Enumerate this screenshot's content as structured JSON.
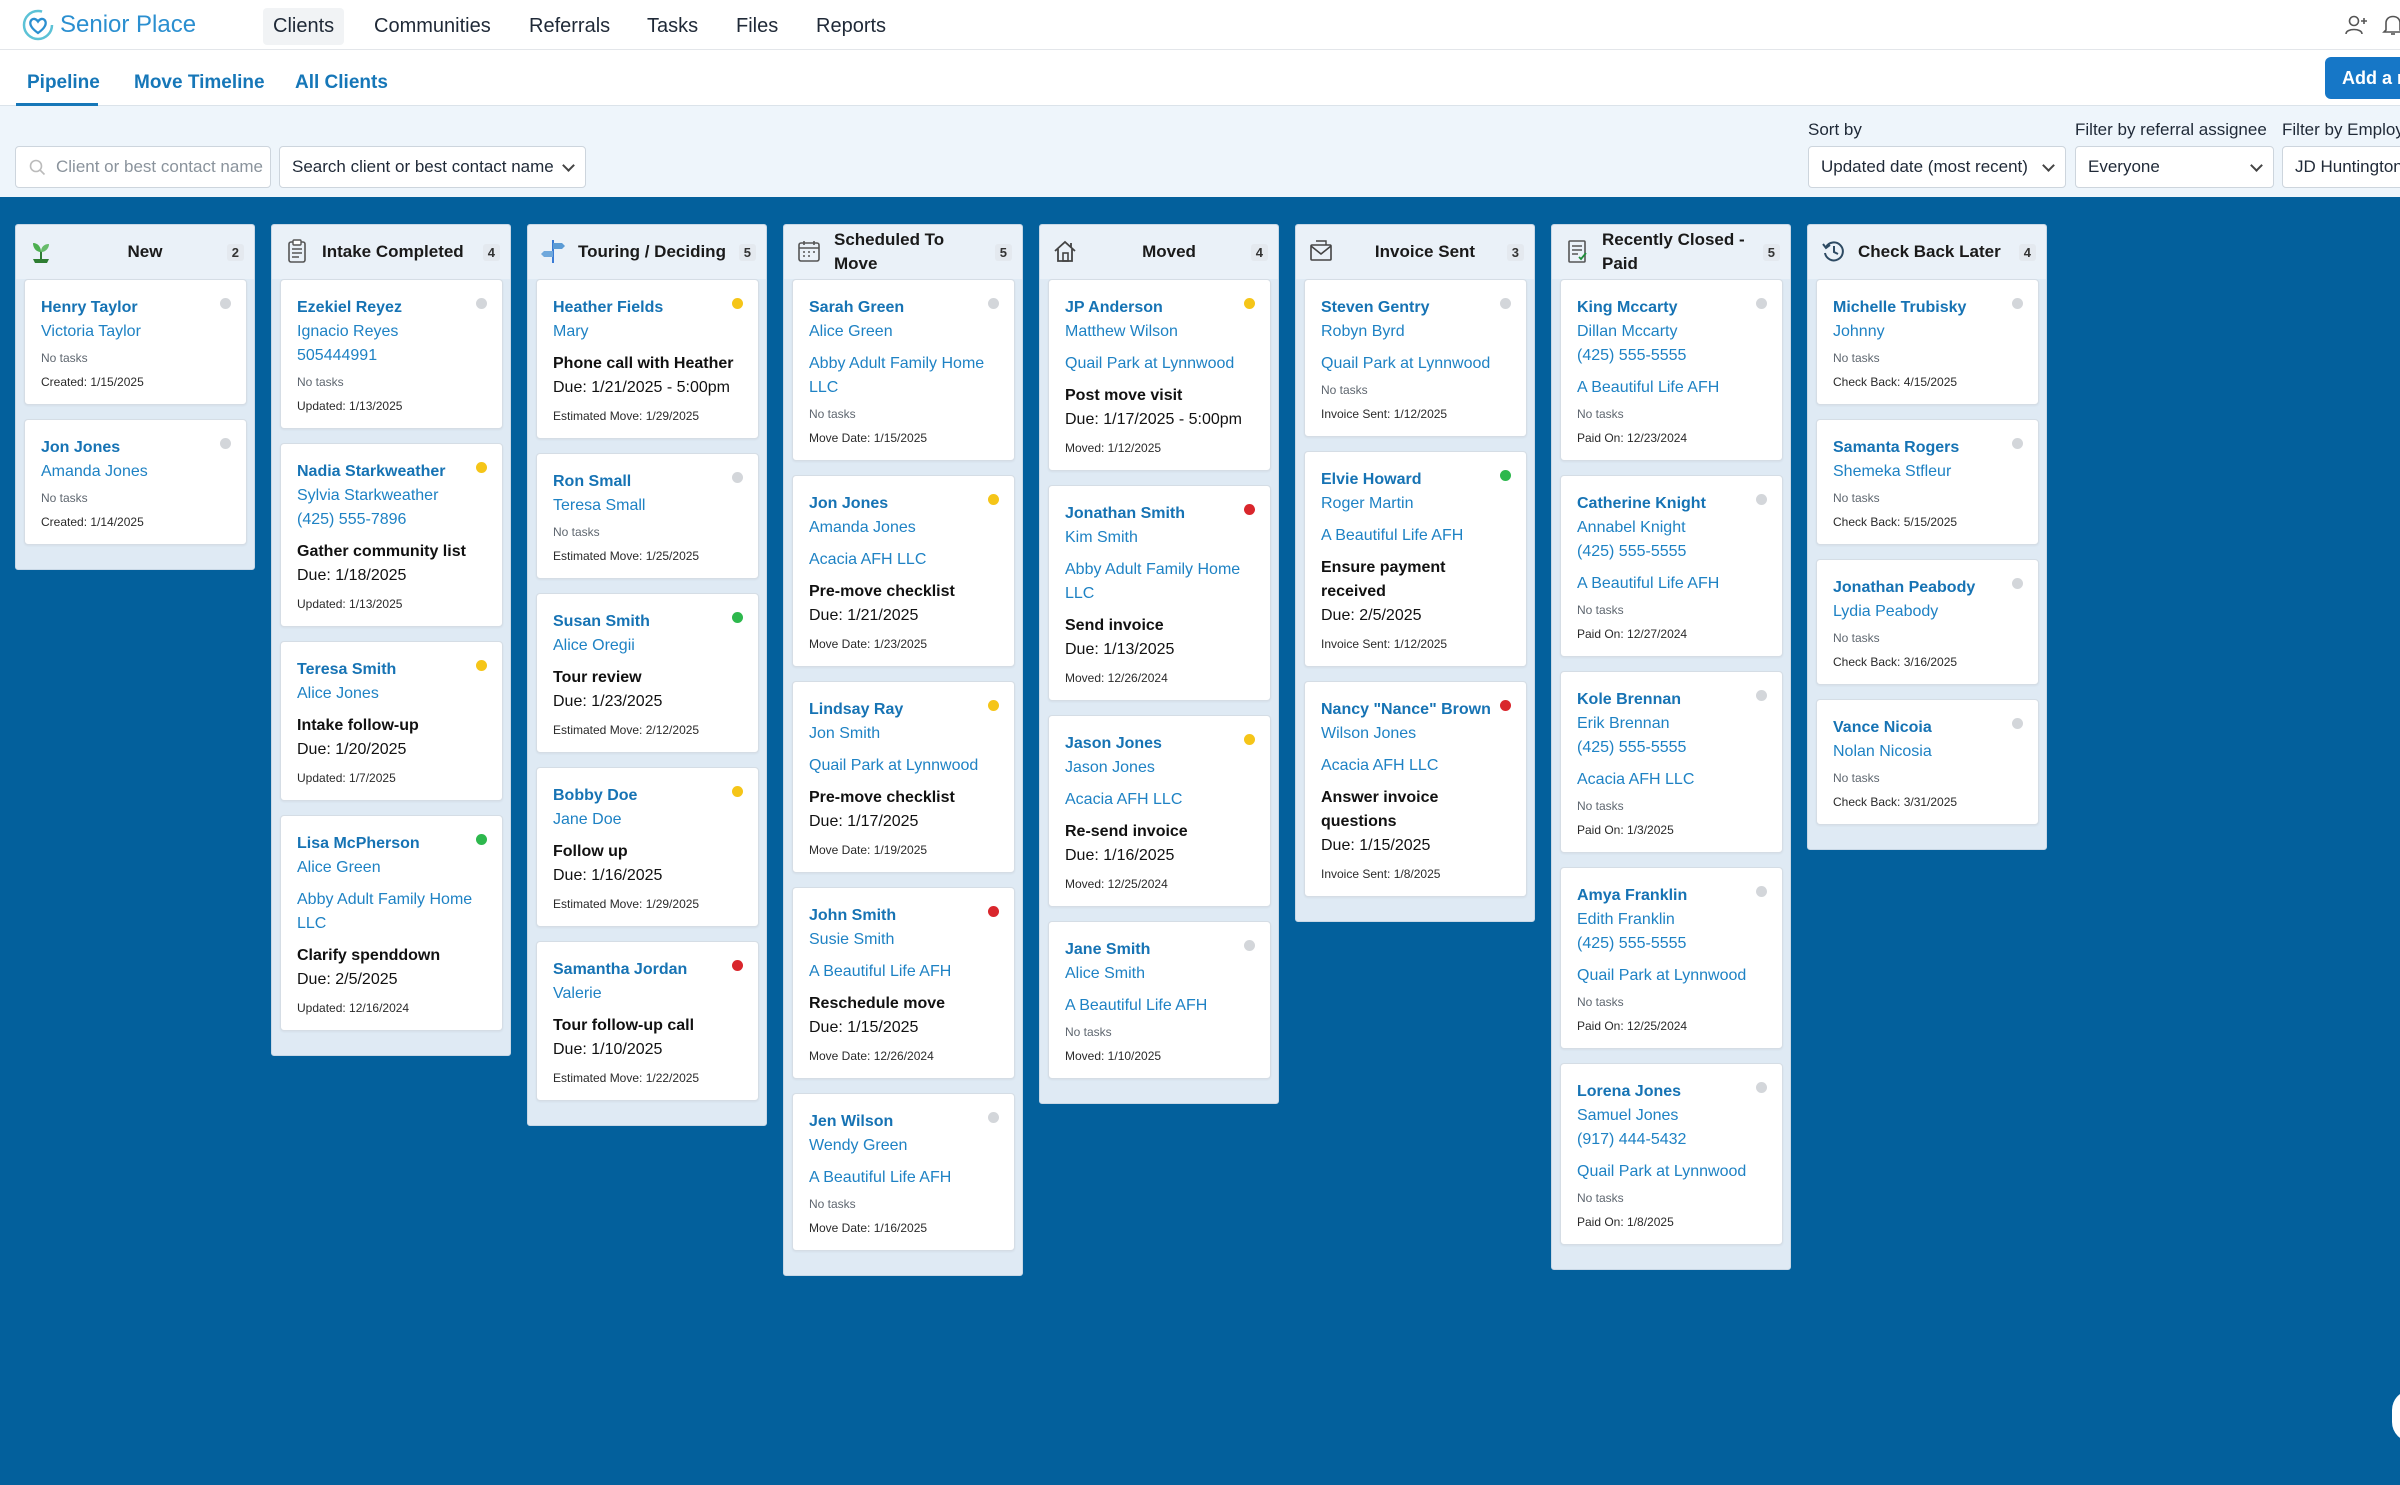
{
  "app": {
    "name": "Senior Place"
  },
  "nav": {
    "items": [
      "Clients",
      "Communities",
      "Referrals",
      "Tasks",
      "Files",
      "Reports"
    ],
    "active": "Clients"
  },
  "tabs": {
    "items": [
      "Pipeline",
      "Move Timeline",
      "All Clients"
    ],
    "active": "Pipeline"
  },
  "add_button": {
    "label": "Add a n"
  },
  "filters": {
    "search_placeholder": "Client or best contact name",
    "search_select_label": "Search client or best contact name",
    "sort_label": "Sort by",
    "sort_value": "Updated date (most recent)",
    "assignee_label": "Filter by referral assignee",
    "assignee_value": "Everyone",
    "employee_label": "Filter by Employe",
    "employee_value": "JD Huntington"
  },
  "colors": {
    "brand": "#2b8fd0",
    "board_bg": "#03609c",
    "link": "#1673b4",
    "yellow": "#f5c518",
    "green": "#2db84d",
    "red": "#d9262c",
    "gray": "#d3d6da"
  },
  "columns": [
    {
      "key": "new",
      "title": "New",
      "count": "2",
      "icon": "seedling-icon",
      "cards": [
        {
          "name": "Henry Taylor",
          "contact": "Victoria Taylor",
          "no_tasks": "No tasks",
          "date_label": "Created: 1/15/2025",
          "status": "gray"
        },
        {
          "name": "Jon Jones",
          "contact": "Amanda Jones",
          "no_tasks": "No tasks",
          "date_label": "Created: 1/14/2025",
          "status": "gray"
        }
      ]
    },
    {
      "key": "intake",
      "title": "Intake Completed",
      "count": "4",
      "icon": "clipboard-icon",
      "cards": [
        {
          "name": "Ezekiel Reyez",
          "contact": "Ignacio Reyes",
          "phone": "505444991",
          "no_tasks": "No tasks",
          "date_label": "Updated: 1/13/2025",
          "status": "gray"
        },
        {
          "name": "Nadia Starkweather",
          "contact": "Sylvia Starkweather",
          "phone": "(425) 555-7896",
          "task": "Gather community list",
          "due": "Due: 1/18/2025",
          "date_label": "Updated: 1/13/2025",
          "status": "yellow"
        },
        {
          "name": "Teresa Smith",
          "contact": "Alice Jones",
          "task": "Intake follow-up",
          "due": "Due: 1/20/2025",
          "date_label": "Updated: 1/7/2025",
          "status": "yellow"
        },
        {
          "name": "Lisa McPherson",
          "contact": "Alice Green",
          "community": "Abby Adult Family Home LLC",
          "task": "Clarify spenddown",
          "due": "Due: 2/5/2025",
          "date_label": "Updated: 12/16/2024",
          "status": "green"
        }
      ]
    },
    {
      "key": "touring",
      "title": "Touring / Deciding",
      "count": "5",
      "icon": "signpost-icon",
      "cards": [
        {
          "name": "Heather Fields",
          "contact": "Mary",
          "task": "Phone call with Heather",
          "due": "Due: 1/21/2025 - 5:00pm",
          "date_label": "Estimated Move: 1/29/2025",
          "status": "yellow"
        },
        {
          "name": "Ron Small",
          "contact": "Teresa Small",
          "no_tasks": "No tasks",
          "date_label": "Estimated Move: 1/25/2025",
          "status": "gray"
        },
        {
          "name": "Susan Smith",
          "contact": "Alice Oregii",
          "task": "Tour review",
          "due": "Due: 1/23/2025",
          "date_label": "Estimated Move: 2/12/2025",
          "status": "green"
        },
        {
          "name": "Bobby Doe",
          "contact": "Jane Doe",
          "task": "Follow up",
          "due": "Due: 1/16/2025",
          "date_label": "Estimated Move: 1/29/2025",
          "status": "yellow"
        },
        {
          "name": "Samantha Jordan",
          "contact": "Valerie",
          "task": "Tour follow-up call",
          "due": "Due: 1/10/2025",
          "date_label": "Estimated Move: 1/22/2025",
          "status": "red"
        }
      ]
    },
    {
      "key": "scheduled",
      "title": "Scheduled To Move",
      "count": "5",
      "icon": "calendar-icon",
      "cards": [
        {
          "name": "Sarah Green",
          "contact": "Alice Green",
          "community": "Abby Adult Family Home LLC",
          "no_tasks": "No tasks",
          "date_label": "Move Date: 1/15/2025",
          "status": "gray"
        },
        {
          "name": "Jon Jones",
          "contact": "Amanda Jones",
          "community": "Acacia AFH LLC",
          "task": "Pre-move checklist",
          "due": "Due: 1/21/2025",
          "date_label": "Move Date: 1/23/2025",
          "status": "yellow"
        },
        {
          "name": "Lindsay Ray",
          "contact": "Jon Smith",
          "community": "Quail Park at Lynnwood",
          "task": "Pre-move checklist",
          "due": "Due: 1/17/2025",
          "date_label": "Move Date: 1/19/2025",
          "status": "yellow"
        },
        {
          "name": "John Smith",
          "contact": "Susie Smith",
          "community": "A Beautiful Life AFH",
          "task": "Reschedule move",
          "due": "Due: 1/15/2025",
          "date_label": "Move Date: 12/26/2024",
          "status": "red"
        },
        {
          "name": "Jen Wilson",
          "contact": "Wendy Green",
          "community": "A Beautiful Life AFH",
          "no_tasks": "No tasks",
          "date_label": "Move Date: 1/16/2025",
          "status": "gray"
        }
      ]
    },
    {
      "key": "moved",
      "title": "Moved",
      "count": "4",
      "icon": "house-icon",
      "cards": [
        {
          "name": "JP Anderson",
          "contact": "Matthew Wilson",
          "community": "Quail Park at Lynnwood",
          "task": "Post move visit",
          "due": "Due: 1/17/2025 - 5:00pm",
          "date_label": "Moved: 1/12/2025",
          "status": "yellow"
        },
        {
          "name": "Jonathan Smith",
          "contact": "Kim Smith",
          "community": "Abby Adult Family Home LLC",
          "task": "Send invoice",
          "due": "Due: 1/13/2025",
          "date_label": "Moved: 12/26/2024",
          "status": "red"
        },
        {
          "name": "Jason Jones",
          "contact": "Jason Jones",
          "community": "Acacia AFH LLC",
          "task": "Re-send invoice",
          "due": "Due: 1/16/2025",
          "date_label": "Moved: 12/25/2024",
          "status": "yellow"
        },
        {
          "name": "Jane Smith",
          "contact": "Alice Smith",
          "community": "A Beautiful Life AFH",
          "no_tasks": "No tasks",
          "date_label": "Moved: 1/10/2025",
          "status": "gray"
        }
      ]
    },
    {
      "key": "invoice",
      "title": "Invoice Sent",
      "count": "3",
      "icon": "envelope-icon",
      "cards": [
        {
          "name": "Steven Gentry",
          "contact": "Robyn Byrd",
          "community": "Quail Park at Lynnwood",
          "no_tasks": "No tasks",
          "date_label": "Invoice Sent: 1/12/2025",
          "status": "gray"
        },
        {
          "name": "Elvie Howard",
          "contact": "Roger Martin",
          "community": "A Beautiful Life AFH",
          "task": "Ensure payment received",
          "due": "Due: 2/5/2025",
          "date_label": "Invoice Sent: 1/12/2025",
          "status": "green"
        },
        {
          "name": "Nancy \"Nance\" Brown",
          "contact": "Wilson Jones",
          "community": "Acacia AFH LLC",
          "task": "Answer invoice questions",
          "due": "Due: 1/15/2025",
          "date_label": "Invoice Sent: 1/8/2025",
          "status": "red"
        }
      ]
    },
    {
      "key": "closed",
      "title": "Recently Closed - Paid",
      "count": "5",
      "icon": "receipt-icon",
      "cards": [
        {
          "name": "King Mccarty",
          "contact": "Dillan Mccarty",
          "phone": "(425) 555-5555",
          "community": "A Beautiful Life AFH",
          "no_tasks": "No tasks",
          "date_label": "Paid On: 12/23/2024",
          "status": "gray"
        },
        {
          "name": "Catherine Knight",
          "contact": "Annabel Knight",
          "phone": "(425) 555-5555",
          "community": "A Beautiful Life AFH",
          "no_tasks": "No tasks",
          "date_label": "Paid On: 12/27/2024",
          "status": "gray"
        },
        {
          "name": "Kole Brennan",
          "contact": "Erik Brennan",
          "phone": "(425) 555-5555",
          "community": "Acacia AFH LLC",
          "no_tasks": "No tasks",
          "date_label": "Paid On: 1/3/2025",
          "status": "gray"
        },
        {
          "name": "Amya Franklin",
          "contact": "Edith Franklin",
          "phone": "(425) 555-5555",
          "community": "Quail Park at Lynnwood",
          "no_tasks": "No tasks",
          "date_label": "Paid On: 12/25/2024",
          "status": "gray"
        },
        {
          "name": "Lorena Jones",
          "contact": "Samuel Jones",
          "phone": "(917) 444-5432",
          "community": "Quail Park at Lynnwood",
          "no_tasks": "No tasks",
          "date_label": "Paid On: 1/8/2025",
          "status": "gray"
        }
      ]
    },
    {
      "key": "checkback",
      "title": "Check Back Later",
      "count": "4",
      "icon": "history-icon",
      "cards": [
        {
          "name": "Michelle Trubisky",
          "contact": "Johnny",
          "no_tasks": "No tasks",
          "date_label": "Check Back: 4/15/2025",
          "status": "gray"
        },
        {
          "name": "Samanta Rogers",
          "contact": "Shemeka Stfleur",
          "no_tasks": "No tasks",
          "date_label": "Check Back: 5/15/2025",
          "status": "gray"
        },
        {
          "name": "Jonathan Peabody",
          "contact": "Lydia Peabody",
          "no_tasks": "No tasks",
          "date_label": "Check Back: 3/16/2025",
          "status": "gray"
        },
        {
          "name": "Vance Nicoia",
          "contact": "Nolan Nicosia",
          "no_tasks": "No tasks",
          "date_label": "Check Back: 3/31/2025",
          "status": "gray"
        }
      ]
    }
  ]
}
